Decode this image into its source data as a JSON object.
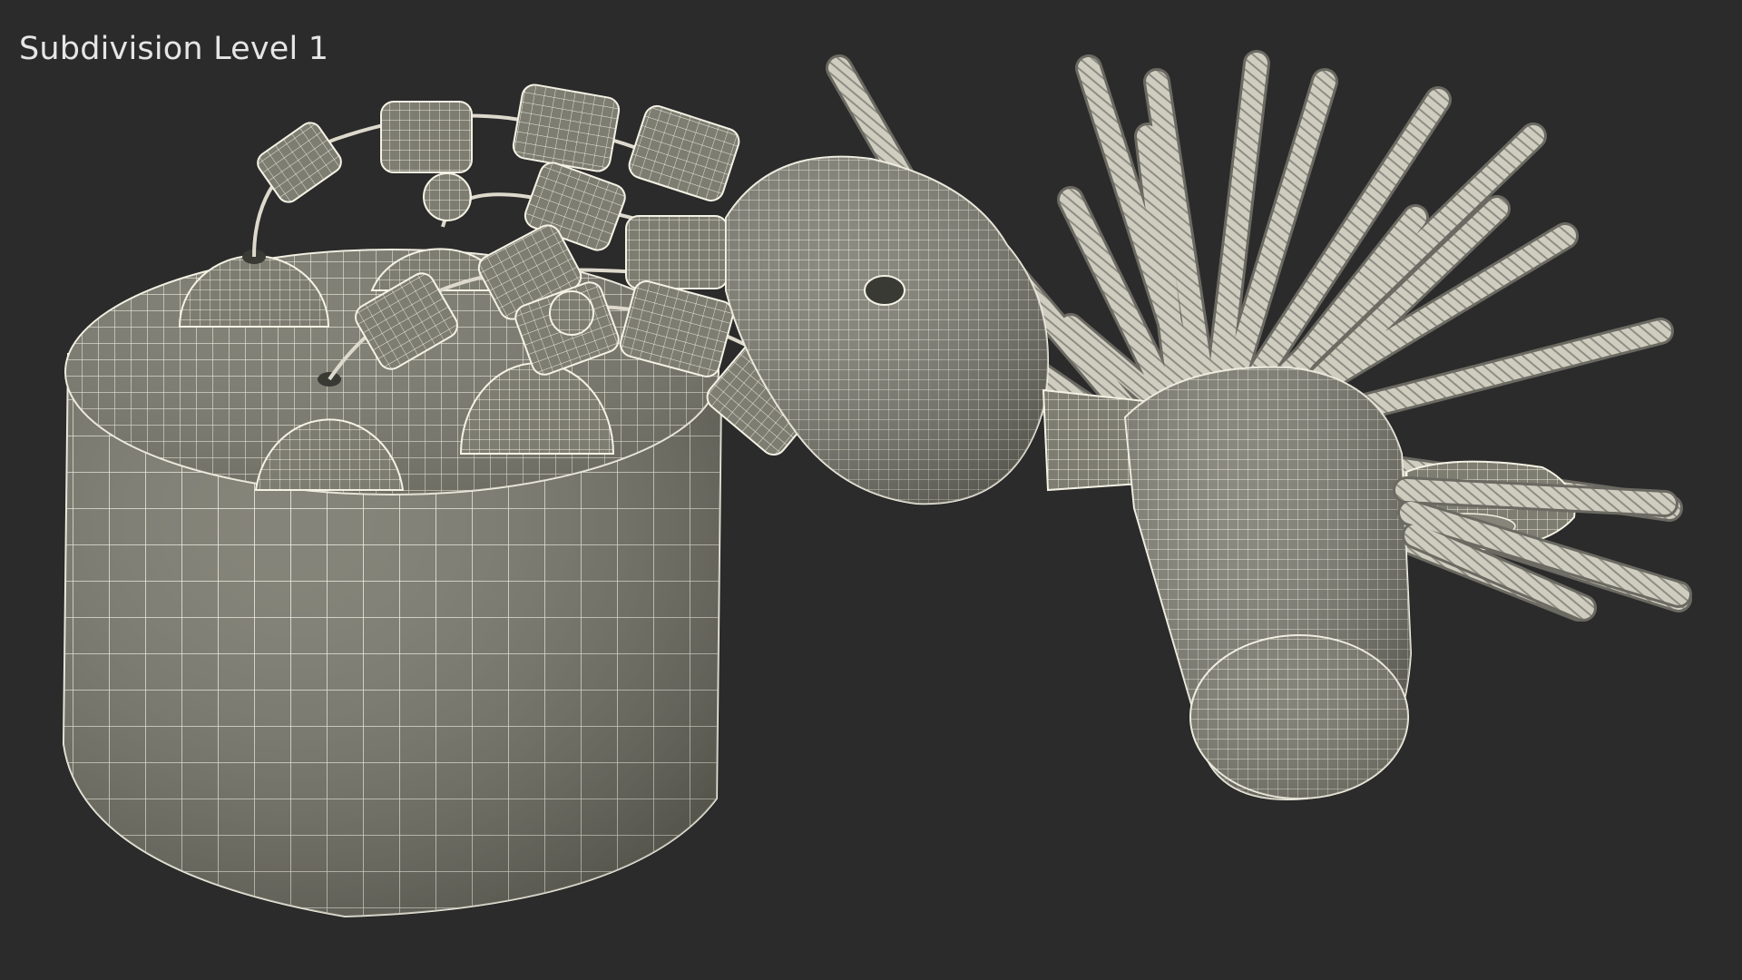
{
  "viewport": {
    "subdivision_label": "Subdivision Level 1"
  },
  "render": {
    "background": "#2b2b2b",
    "surface_color": "#77776b",
    "wire_color": "#f4f2e4",
    "rope_color": "#d4d2c6"
  }
}
